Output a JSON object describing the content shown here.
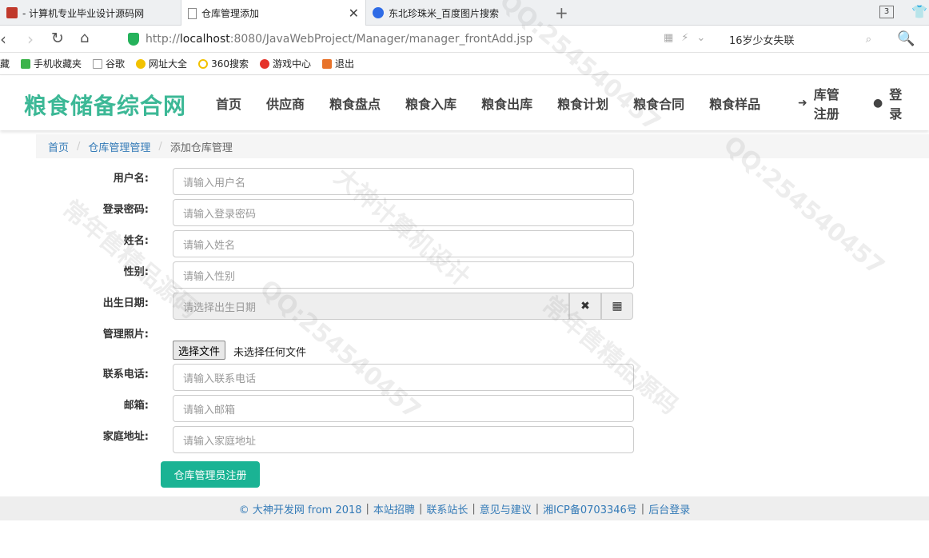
{
  "tabs": [
    {
      "title": "- 计算机专业毕业设计源码网",
      "icon": "flag-icon"
    },
    {
      "title": "仓库管理添加",
      "icon": "page-icon"
    },
    {
      "title": "东北珍珠米_百度图片搜索",
      "icon": "baidu-icon"
    }
  ],
  "tab_count": "3",
  "address": {
    "prefix": "http://",
    "host": "localhost",
    "path": ":8080/JavaWebProject/Manager/manager_frontAdd.jsp"
  },
  "search": {
    "value": "16岁少女失联"
  },
  "bookmarks": [
    "藏",
    "手机收藏夹",
    "谷歌",
    "网址大全",
    "360搜索",
    "游戏中心",
    "退出"
  ],
  "site": {
    "logo": "粮食储备综合网",
    "menu": [
      "首页",
      "供应商",
      "粮食盘点",
      "粮食入库",
      "粮食出库",
      "粮食计划",
      "粮食合同",
      "粮食样品"
    ],
    "register": "库管注册",
    "login": "登录"
  },
  "breadcrumb": {
    "home": "首页",
    "section": "仓库管理管理",
    "current": "添加仓库管理"
  },
  "form": {
    "username": {
      "label": "用户名:",
      "placeholder": "请输入用户名"
    },
    "password": {
      "label": "登录密码:",
      "placeholder": "请输入登录密码"
    },
    "name": {
      "label": "姓名:",
      "placeholder": "请输入姓名"
    },
    "sex": {
      "label": "性别:",
      "placeholder": "请输入性别"
    },
    "birthday": {
      "label": "出生日期:",
      "placeholder": "请选择出生日期"
    },
    "photo": {
      "label": "管理照片:",
      "button": "选择文件",
      "status": "未选择任何文件"
    },
    "phone": {
      "label": "联系电话:",
      "placeholder": "请输入联系电话"
    },
    "email": {
      "label": "邮箱:",
      "placeholder": "请输入邮箱"
    },
    "address": {
      "label": "家庭地址:",
      "placeholder": "请输入家庭地址"
    },
    "submit": "仓库管理员注册"
  },
  "footer": {
    "copyright": "© 大神开发网 from 2018",
    "links": [
      "本站招聘",
      "联系站长",
      "意见与建议",
      "湘ICP备0703346号",
      "后台登录"
    ]
  },
  "watermarks": [
    "QQ:254540457",
    "大神计算机设计",
    "常年售精品源码"
  ],
  "colors": {
    "brand": "#3cb896",
    "submit": "#1ab394",
    "link": "#337ab7"
  }
}
